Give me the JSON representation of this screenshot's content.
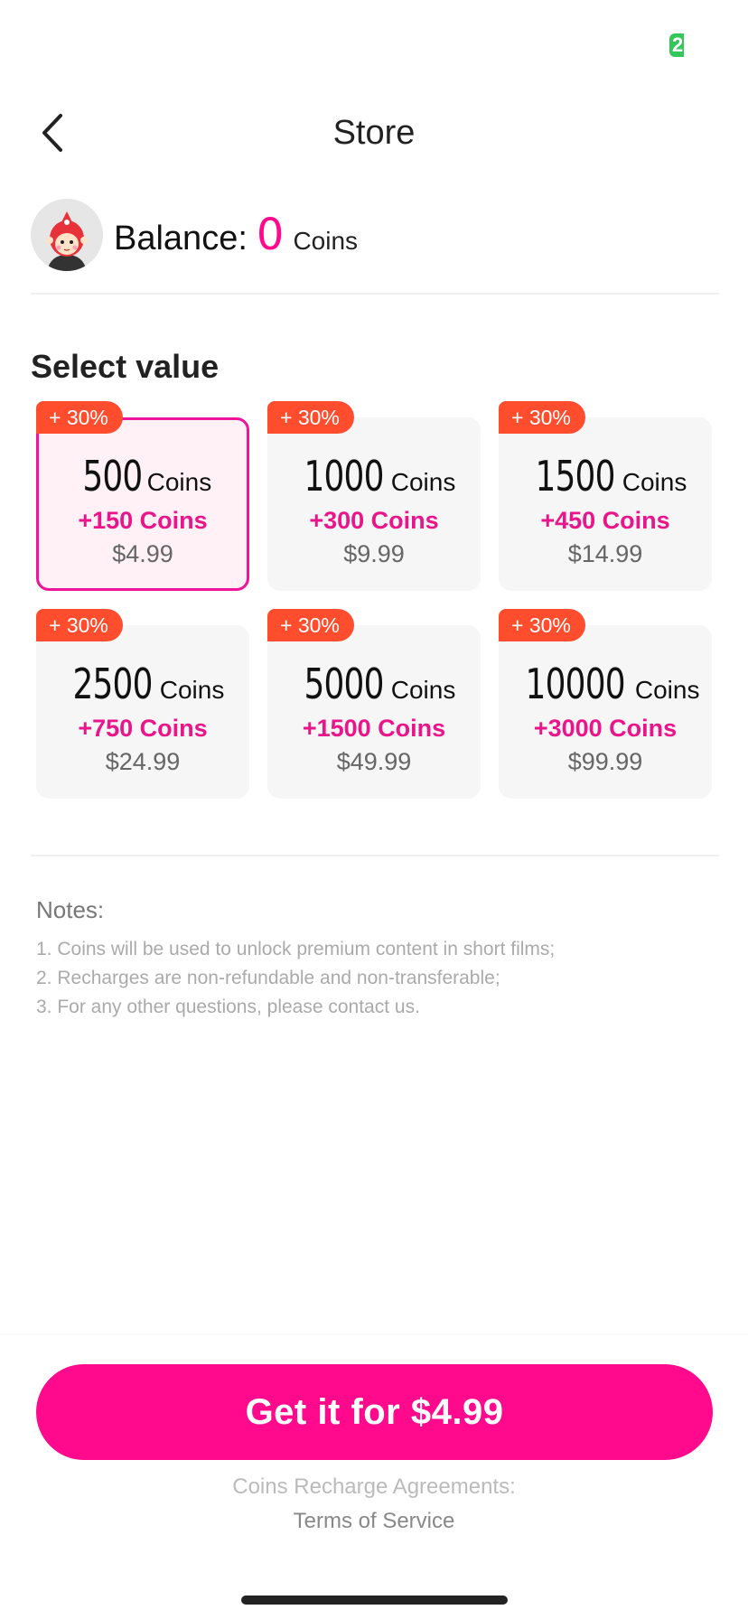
{
  "status_bar": {
    "badge_text": "2",
    "badge_color": "#34c759"
  },
  "header": {
    "title": "Store",
    "back_icon": "chevron-left-icon"
  },
  "balance": {
    "label": "Balance:",
    "value": "0",
    "unit": "Coins",
    "avatar_icon": "mascot-avatar-icon"
  },
  "section_title": "Select value",
  "accent_color": "#ff0a8c",
  "badge_color": "#ff4d2e",
  "packages": [
    {
      "badge": "+ 30%",
      "coins": "500",
      "unit": "Coins",
      "bonus": "+150 Coins",
      "price": "$4.99",
      "selected": true
    },
    {
      "badge": "+ 30%",
      "coins": "1000",
      "unit": "Coins",
      "bonus": "+300 Coins",
      "price": "$9.99",
      "selected": false
    },
    {
      "badge": "+ 30%",
      "coins": "1500",
      "unit": "Coins",
      "bonus": "+450 Coins",
      "price": "$14.99",
      "selected": false
    },
    {
      "badge": "+ 30%",
      "coins": "2500",
      "unit": "Coins",
      "bonus": "+750 Coins",
      "price": "$24.99",
      "selected": false
    },
    {
      "badge": "+ 30%",
      "coins": "5000",
      "unit": "Coins",
      "bonus": "+1500 Coins",
      "price": "$49.99",
      "selected": false
    },
    {
      "badge": "+ 30%",
      "coins": "10000",
      "unit": "Coins",
      "bonus": "+3000 Coins",
      "price": "$99.99",
      "selected": false
    }
  ],
  "notes": {
    "title": "Notes:",
    "lines": [
      "1. Coins will be used to unlock premium content in short  films;",
      "2. Recharges are non-refundable and non-transferable;",
      "3. For any other questions, please contact us."
    ]
  },
  "footer": {
    "cta_label": "Get it for $4.99",
    "agreement_label": "Coins Recharge Agreements:",
    "terms_link": "Terms of Service"
  }
}
